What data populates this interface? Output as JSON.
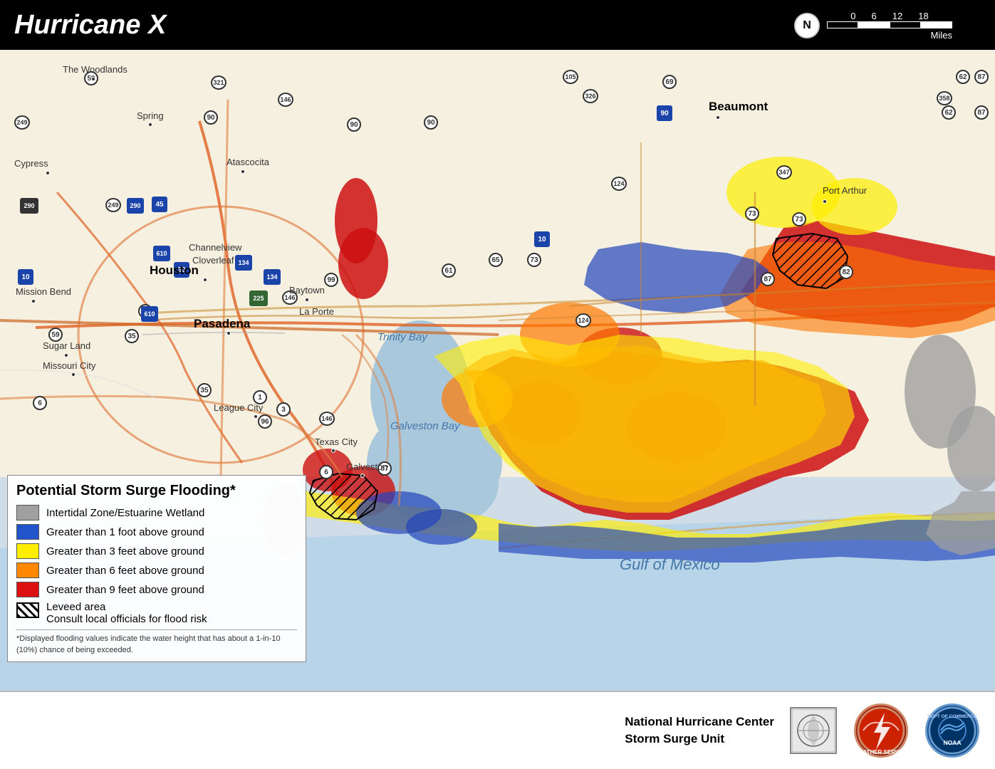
{
  "header": {
    "title": "Hurricane X"
  },
  "scale": {
    "north_label": "N",
    "values": [
      "0",
      "6",
      "12",
      "18"
    ],
    "unit": "Miles"
  },
  "legend": {
    "title": "Potential Storm Surge Flooding*",
    "items": [
      {
        "id": "intertidal",
        "color": "gray",
        "label": "Intertidal Zone/Estuarine Wetland"
      },
      {
        "id": "1ft",
        "color": "blue",
        "label": "Greater than 1 foot above ground"
      },
      {
        "id": "3ft",
        "color": "yellow",
        "label": "Greater than 3 feet above ground"
      },
      {
        "id": "6ft",
        "color": "orange",
        "label": "Greater than 6 feet above ground"
      },
      {
        "id": "9ft",
        "color": "red",
        "label": "Greater than 9 feet above ground"
      },
      {
        "id": "levee",
        "color": "hatch",
        "label": "Leveed area\nConsult local officials for flood risk"
      }
    ],
    "footnote": "*Displayed flooding values indicate the water height that has about a 1-in-10 (10%) chance of being exceeded."
  },
  "places": [
    {
      "id": "houston",
      "label": "Houston",
      "bold": true
    },
    {
      "id": "beaumont",
      "label": "Beaumont",
      "bold": true
    },
    {
      "id": "port_arthur",
      "label": "Port Arthur",
      "bold": false
    },
    {
      "id": "pasadena",
      "label": "Pasadena",
      "bold": true
    },
    {
      "id": "baytown",
      "label": "Baytown",
      "bold": false
    },
    {
      "id": "la_porte",
      "label": "La Porte",
      "bold": false
    },
    {
      "id": "league_city",
      "label": "League City",
      "bold": false
    },
    {
      "id": "galveston",
      "label": "Galveston",
      "bold": false
    },
    {
      "id": "texas_city",
      "label": "Texas City",
      "bold": false
    },
    {
      "id": "the_woodlands",
      "label": "The Woodlands",
      "bold": false
    },
    {
      "id": "spring",
      "label": "Spring",
      "bold": false
    },
    {
      "id": "atascocita",
      "label": "Atascocita",
      "bold": false
    },
    {
      "id": "channelview",
      "label": "Channelview",
      "bold": false
    },
    {
      "id": "cloverleaf",
      "label": "Cloverleaf",
      "bold": false
    },
    {
      "id": "cypress",
      "label": "Cypress",
      "bold": false
    },
    {
      "id": "mission_bend",
      "label": "Mission Bend",
      "bold": false
    },
    {
      "id": "sugar_land",
      "label": "Sugar Land",
      "bold": false
    },
    {
      "id": "missouri_city",
      "label": "Missouri City",
      "bold": false
    }
  ],
  "water_labels": [
    {
      "id": "trinity_bay",
      "label": "Trinity Bay"
    },
    {
      "id": "galveston_bay",
      "label": "Galveston Bay"
    },
    {
      "id": "gulf_of_mexico",
      "label": "Gulf of Mexico"
    }
  ],
  "agency": {
    "noaa_label": "NOAA",
    "nws_label": "NWS",
    "nhc_label": "NHC",
    "name_line1": "National Hurricane Center",
    "name_line2": "Storm Surge Unit"
  }
}
